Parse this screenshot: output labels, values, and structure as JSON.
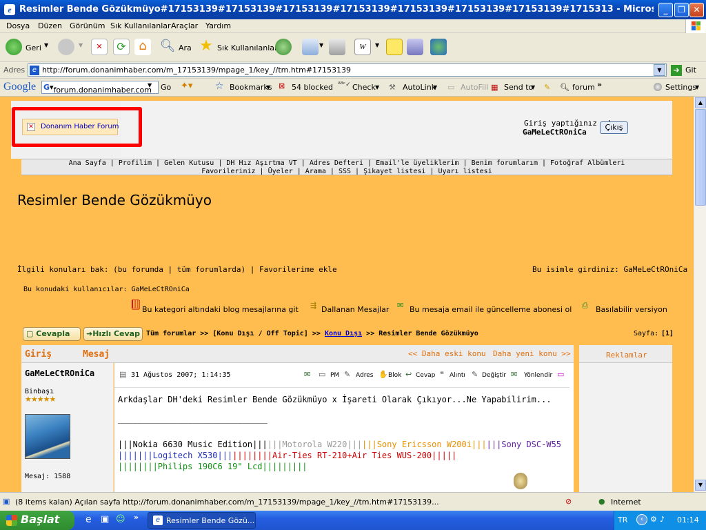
{
  "window": {
    "title": "Resimler Bende Gözükmüyo#17153139#17153139#17153139#17153139#17153139#17153139#17153139#1715313 - Microsoft Internet Explorer"
  },
  "menu": [
    "Dosya",
    "Düzen",
    "Görünüm",
    "Sık Kullanılanlar",
    "Araçlar",
    "Yardım"
  ],
  "toolbar": {
    "back": "Geri",
    "search": "Ara",
    "favorites": "Sık Kullanılanlar"
  },
  "address": {
    "label": "Adres",
    "url": "http://forum.donanimhaber.com/m_17153139/mpage_1/key_//tm.htm#17153139",
    "go": "Git"
  },
  "google": {
    "logo": "Google",
    "query": "forum.donanimhaber.com",
    "go": "Go",
    "bookmarks": "Bookmarks",
    "blocked": "54 blocked",
    "check": "Check",
    "autolink": "AutoLink",
    "autofill": "AutoFill",
    "sendto": "Send to",
    "forum": "forum",
    "settings": "Settings"
  },
  "page": {
    "logo_text": "Donanım Haber Forum",
    "login_label": "Giriş yaptığınız ad",
    "username": "GaMeLeCtROniCa",
    "logout": "Çıkış",
    "nav1": [
      "Ana Sayfa",
      "Profilim",
      "Gelen Kutusu",
      "DH Hız Aşırtma VT",
      "Adres Defteri",
      "Email'le üyeliklerim",
      "Benim forumlarım",
      "Fotoğraf Albümleri"
    ],
    "nav2": [
      "Favorileriniz",
      "Üyeler",
      "Arama",
      "SSS",
      "Şikayet listesi",
      "Uyarı listesi"
    ],
    "topic_title": "Resimler Bende Gözükmüyo",
    "related": "İlgili konuları bak: (bu forumda | tüm forumlarda) | Favorilerime ekle",
    "entered_as": "Bu isimle girdiniz: GaMeLeCtROniCa",
    "users_in_topic": "Bu konudaki kullanıcılar: GaMeLeCtROniCa",
    "links": {
      "blog": "Bu kategori altındaki blog mesajlarına git",
      "branch": "Dallanan Mesajlar",
      "email": "Bu mesaja email ile güncelleme abonesi ol",
      "print": "Basılabilir versiyon"
    },
    "reply": "Cevapla",
    "quick_reply": "Hızlı Cevap",
    "breadcrumb": {
      "all": "Tüm forumlar",
      "sep": ">>",
      "cat": "[Konu Dışı / Off Topic]",
      "sub": "Konu Dışı",
      "topic": "Resimler Bende Gözükmüyo"
    },
    "pages_label": "Sayfa:",
    "pages_value": "[1]",
    "col_login": "Giriş",
    "col_message": "Mesaj",
    "older": "<< Daha eski konu",
    "newer": "Daha yeni konu >>",
    "ads": "Reklamlar",
    "post": {
      "author": "GaMeLeCtROniCa",
      "rank": "Binbaşı",
      "stars": "★★★★★",
      "count": "Mesaj: 1588",
      "date": "31 Ağustos 2007; 1:14:35",
      "actions": [
        "PM",
        "Adres",
        "Blok",
        "Cevap",
        "Alıntı",
        "Değiştir",
        "Yönlendir"
      ],
      "body": "Arkdaşlar DH'deki Resimler Bende Gözükmüyo x İşareti Olarak Çıkıyor...Ne Yapabilirim...",
      "rule": "______________________________",
      "sig1a": "|||Nokia 6630 Music Edition|||",
      "sig1b": "|||Motorola W220|||",
      "sig1c": "|||Sony Ericsson W200i|||",
      "sig1d": "|||Sony DSC-W55",
      "sig2a": "|||||||Logitech X530|||",
      "sig2b": "||||||||Air-Ties RT-210+Air Ties WUS-200|||||",
      "sig3": "||||||||Philips 190C6 19\" Lcd|||||||||"
    }
  },
  "status": {
    "text": "(8 items kalan) Açılan sayfa http://forum.donanimhaber.com/m_17153139/mpage_1/key_//tm.htm#17153139...",
    "zone": "Internet"
  },
  "taskbar": {
    "start": "Başlat",
    "task": "Resimler Bende Gözü...",
    "lang": "TR",
    "clock": "01:14"
  },
  "colors": {
    "page_bg": "#ffbd4f",
    "highlight_red": "#ff0000",
    "link": "#0000cc"
  }
}
